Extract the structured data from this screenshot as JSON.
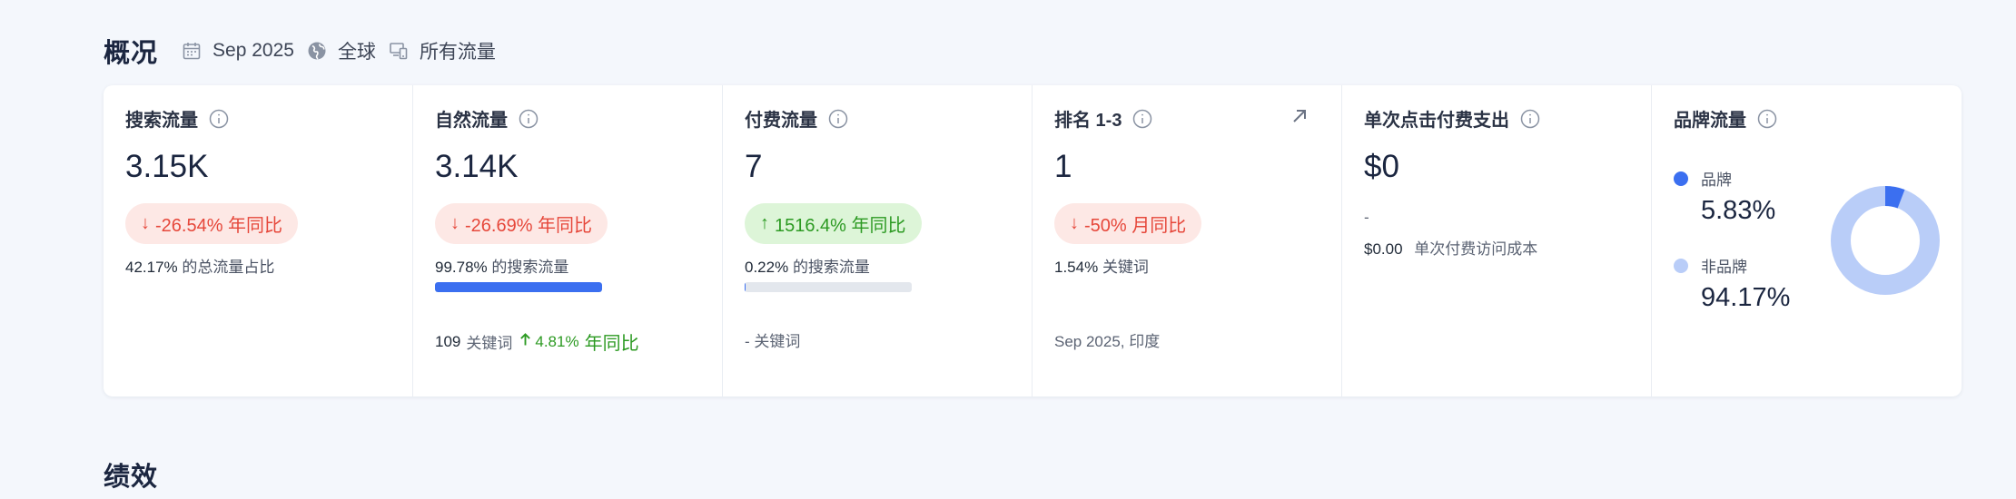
{
  "overview": {
    "title": "概况",
    "filters": {
      "date": "Sep 2025",
      "region": "全球",
      "traffic": "所有流量"
    }
  },
  "cards": {
    "search": {
      "title": "搜索流量",
      "value": "3.15K",
      "change_arrow": "↓",
      "change": "-26.54% 年同比",
      "share_value": "42.17%",
      "share_label": "的总流量占比"
    },
    "organic": {
      "title": "自然流量",
      "value": "3.14K",
      "change_arrow": "↓",
      "change": "-26.69% 年同比",
      "share_value": "99.78%",
      "share_label": "的搜索流量",
      "share_fraction": 0.9978,
      "keywords_count": "109",
      "keywords_label": "关键词",
      "keywords_change": "4.81%",
      "keywords_change_label": "年同比"
    },
    "paid": {
      "title": "付费流量",
      "value": "7",
      "change_arrow": "↑",
      "change": "1516.4% 年同比",
      "share_value": "0.22%",
      "share_label": "的搜索流量",
      "share_fraction": 0.0022,
      "keywords_text": "- 关键词"
    },
    "rank": {
      "title": "排名 1-3",
      "value": "1",
      "change_arrow": "↓",
      "change": "-50% 月同比",
      "keywords_value": "1.54%",
      "keywords_label": "关键词",
      "footer": "Sep 2025, 印度"
    },
    "cpc": {
      "title": "单次点击付费支出",
      "value": "$0",
      "dash": "-",
      "cost_value": "$0.00",
      "cost_label": "单次付费访问成本"
    },
    "brand": {
      "title": "品牌流量",
      "brand_label": "品牌",
      "brand_value": "5.83%",
      "nonbrand_label": "非品牌",
      "nonbrand_value": "94.17%",
      "brand_fraction": 0.0583,
      "colors": {
        "brand": "#3b6ff0",
        "nonbrand": "#b9cdf8"
      }
    }
  },
  "performance": {
    "title": "绩效"
  }
}
